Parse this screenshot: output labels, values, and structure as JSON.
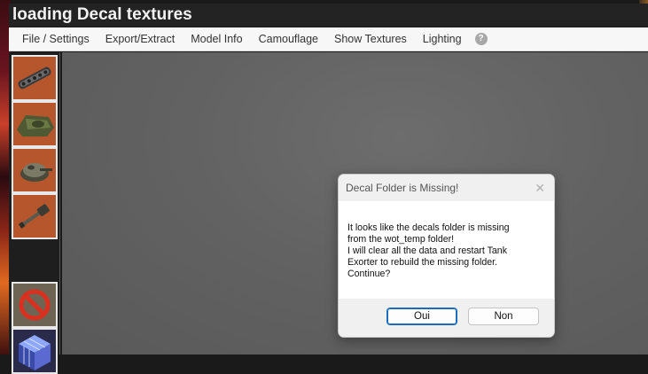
{
  "window": {
    "title": "loading Decal textures"
  },
  "menu": {
    "items": [
      "File / Settings",
      "Export/Extract",
      "Model Info",
      "Camouflage",
      "Show Textures",
      "Lighting"
    ],
    "help_icon": "help-circle-icon"
  },
  "thumbnails": [
    {
      "icon": "tank-tracks-icon"
    },
    {
      "icon": "tank-hull-icon"
    },
    {
      "icon": "tank-turret-icon"
    },
    {
      "icon": "tank-gun-icon"
    },
    {
      "icon": "no-symbol-icon"
    },
    {
      "icon": "cube-icon"
    }
  ],
  "dialog": {
    "title": "Decal Folder is Missing!",
    "close_glyph": "✕",
    "lines": [
      "It looks like the decals folder is missing",
      "from the wot_temp folder!",
      "I will clear all the data and restart Tank",
      "Exorter to rebuild the missing folder.",
      "Continue?"
    ],
    "yes_label": "Oui",
    "no_label": "Non"
  },
  "colors": {
    "titlebar": "#232323",
    "viewport": "#626262",
    "primary_button_border": "#1b6bbf"
  }
}
